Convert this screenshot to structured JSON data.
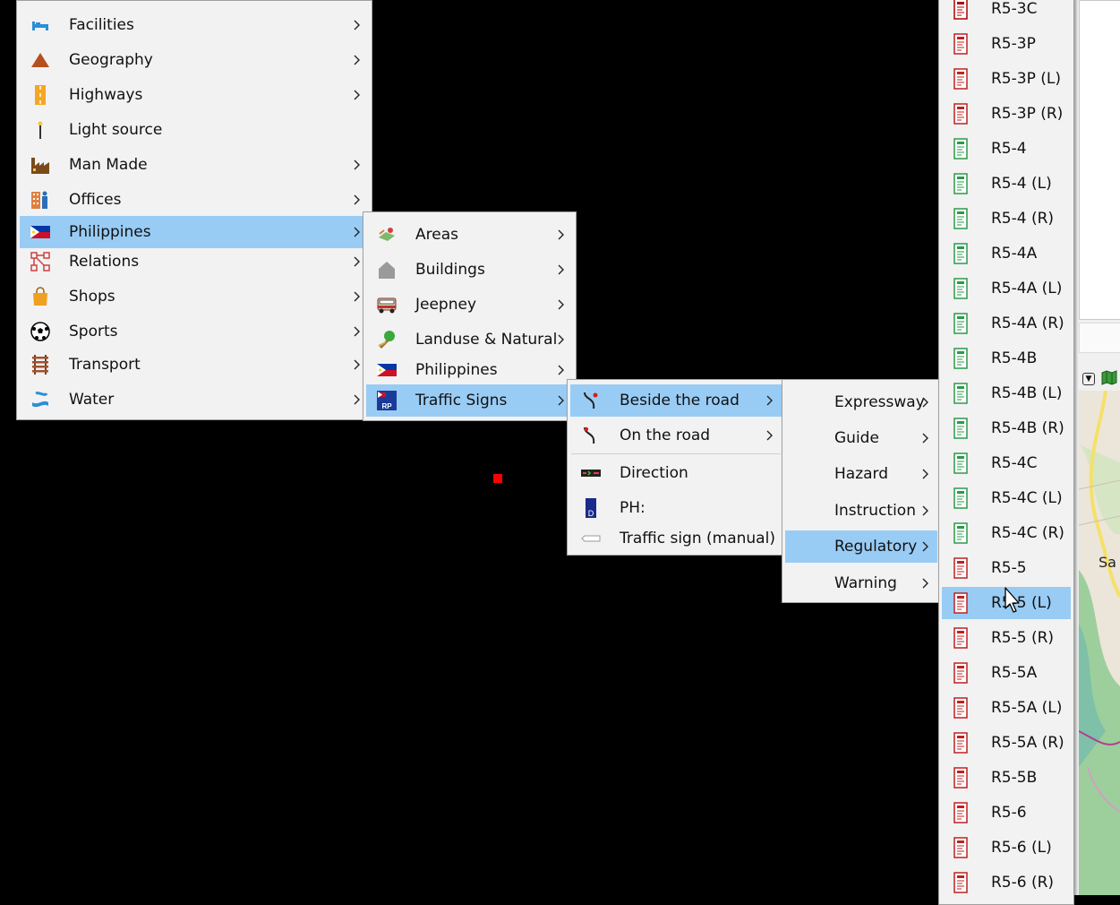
{
  "menus": {
    "main": [
      {
        "label": "Facilities",
        "icon": "bed-icon",
        "sub": true
      },
      {
        "label": "Geography",
        "icon": "mountain-icon",
        "sub": true
      },
      {
        "label": "Highways",
        "icon": "road-icon",
        "sub": true
      },
      {
        "label": "Light source",
        "icon": "street-lamp-icon",
        "sub": false
      },
      {
        "label": "Man Made",
        "icon": "factory-icon",
        "sub": true
      },
      {
        "label": "Offices",
        "icon": "office-building-icon",
        "sub": true
      },
      {
        "label": "Philippines",
        "icon": "philippines-flag-icon",
        "sub": true
      },
      {
        "label": "Relations",
        "icon": "relations-icon",
        "sub": true
      },
      {
        "label": "Shops",
        "icon": "shopping-bag-icon",
        "sub": true
      },
      {
        "label": "Sports",
        "icon": "soccer-ball-icon",
        "sub": true
      },
      {
        "label": "Transport",
        "icon": "railway-track-icon",
        "sub": true
      },
      {
        "label": "Water",
        "icon": "water-icon",
        "sub": true
      }
    ],
    "philippines": [
      {
        "label": "Areas",
        "icon": "areas-icon",
        "sub": true
      },
      {
        "label": "Buildings",
        "icon": "building-icon",
        "sub": true
      },
      {
        "label": "Jeepney",
        "icon": "jeepney-icon",
        "sub": true
      },
      {
        "label": "Landuse & Natural",
        "icon": "tree-icon",
        "sub": true
      },
      {
        "label": "Philippines",
        "icon": "philippines-flag-icon",
        "sub": true
      },
      {
        "label": "Traffic Signs",
        "icon": "rp-sign-icon",
        "sub": true
      }
    ],
    "traffic_signs": [
      {
        "label": "Beside the road",
        "icon": "road-curve-icon",
        "sub": true
      },
      {
        "label": "On the road",
        "icon": "road-arrow-icon",
        "sub": true
      },
      {
        "label": "Direction",
        "icon": "direction-sign-icon",
        "sub": false
      },
      {
        "label": "PH:",
        "icon": "ph-plate-icon",
        "sub": false
      },
      {
        "label": "Traffic sign (manual)",
        "icon": "blank-sign-icon",
        "sub": false
      }
    ],
    "beside_road": [
      {
        "label": "Expressway",
        "sub": true
      },
      {
        "label": "Guide",
        "sub": true
      },
      {
        "label": "Hazard",
        "sub": true
      },
      {
        "label": "Instruction",
        "sub": true
      },
      {
        "label": "Regulatory",
        "sub": true
      },
      {
        "label": "Warning",
        "sub": true
      }
    ],
    "regulatory": [
      {
        "label": "R5-3C",
        "color": "#b00000"
      },
      {
        "label": "R5-3P",
        "color": "#c02020"
      },
      {
        "label": "R5-3P (L)",
        "color": "#c02020"
      },
      {
        "label": "R5-3P (R)",
        "color": "#c02020"
      },
      {
        "label": "R5-4",
        "color": "#2a9a4a"
      },
      {
        "label": "R5-4 (L)",
        "color": "#2a9a4a"
      },
      {
        "label": "R5-4 (R)",
        "color": "#2a9a4a"
      },
      {
        "label": "R5-4A",
        "color": "#2a9a4a"
      },
      {
        "label": "R5-4A (L)",
        "color": "#2a9a4a"
      },
      {
        "label": "R5-4A (R)",
        "color": "#2a9a4a"
      },
      {
        "label": "R5-4B",
        "color": "#2a9a4a"
      },
      {
        "label": "R5-4B (L)",
        "color": "#2a9a4a"
      },
      {
        "label": "R5-4B (R)",
        "color": "#2a9a4a"
      },
      {
        "label": "R5-4C",
        "color": "#2a9a4a"
      },
      {
        "label": "R5-4C (L)",
        "color": "#2a9a4a"
      },
      {
        "label": "R5-4C (R)",
        "color": "#2a9a4a"
      },
      {
        "label": "R5-5",
        "color": "#c02020"
      },
      {
        "label": "R5-5 (L)",
        "color": "#c02020"
      },
      {
        "label": "R5-5 (R)",
        "color": "#c02020"
      },
      {
        "label": "R5-5A",
        "color": "#c02020"
      },
      {
        "label": "R5-5A (L)",
        "color": "#c02020"
      },
      {
        "label": "R5-5A (R)",
        "color": "#c02020"
      },
      {
        "label": "R5-5B",
        "color": "#c02020"
      },
      {
        "label": "R5-6",
        "color": "#c02020"
      },
      {
        "label": "R5-6 (L)",
        "color": "#c02020"
      },
      {
        "label": "R5-6 (R)",
        "color": "#c02020"
      }
    ]
  },
  "highlight_color": "#99ccf5",
  "map_partial_label": "Sa"
}
